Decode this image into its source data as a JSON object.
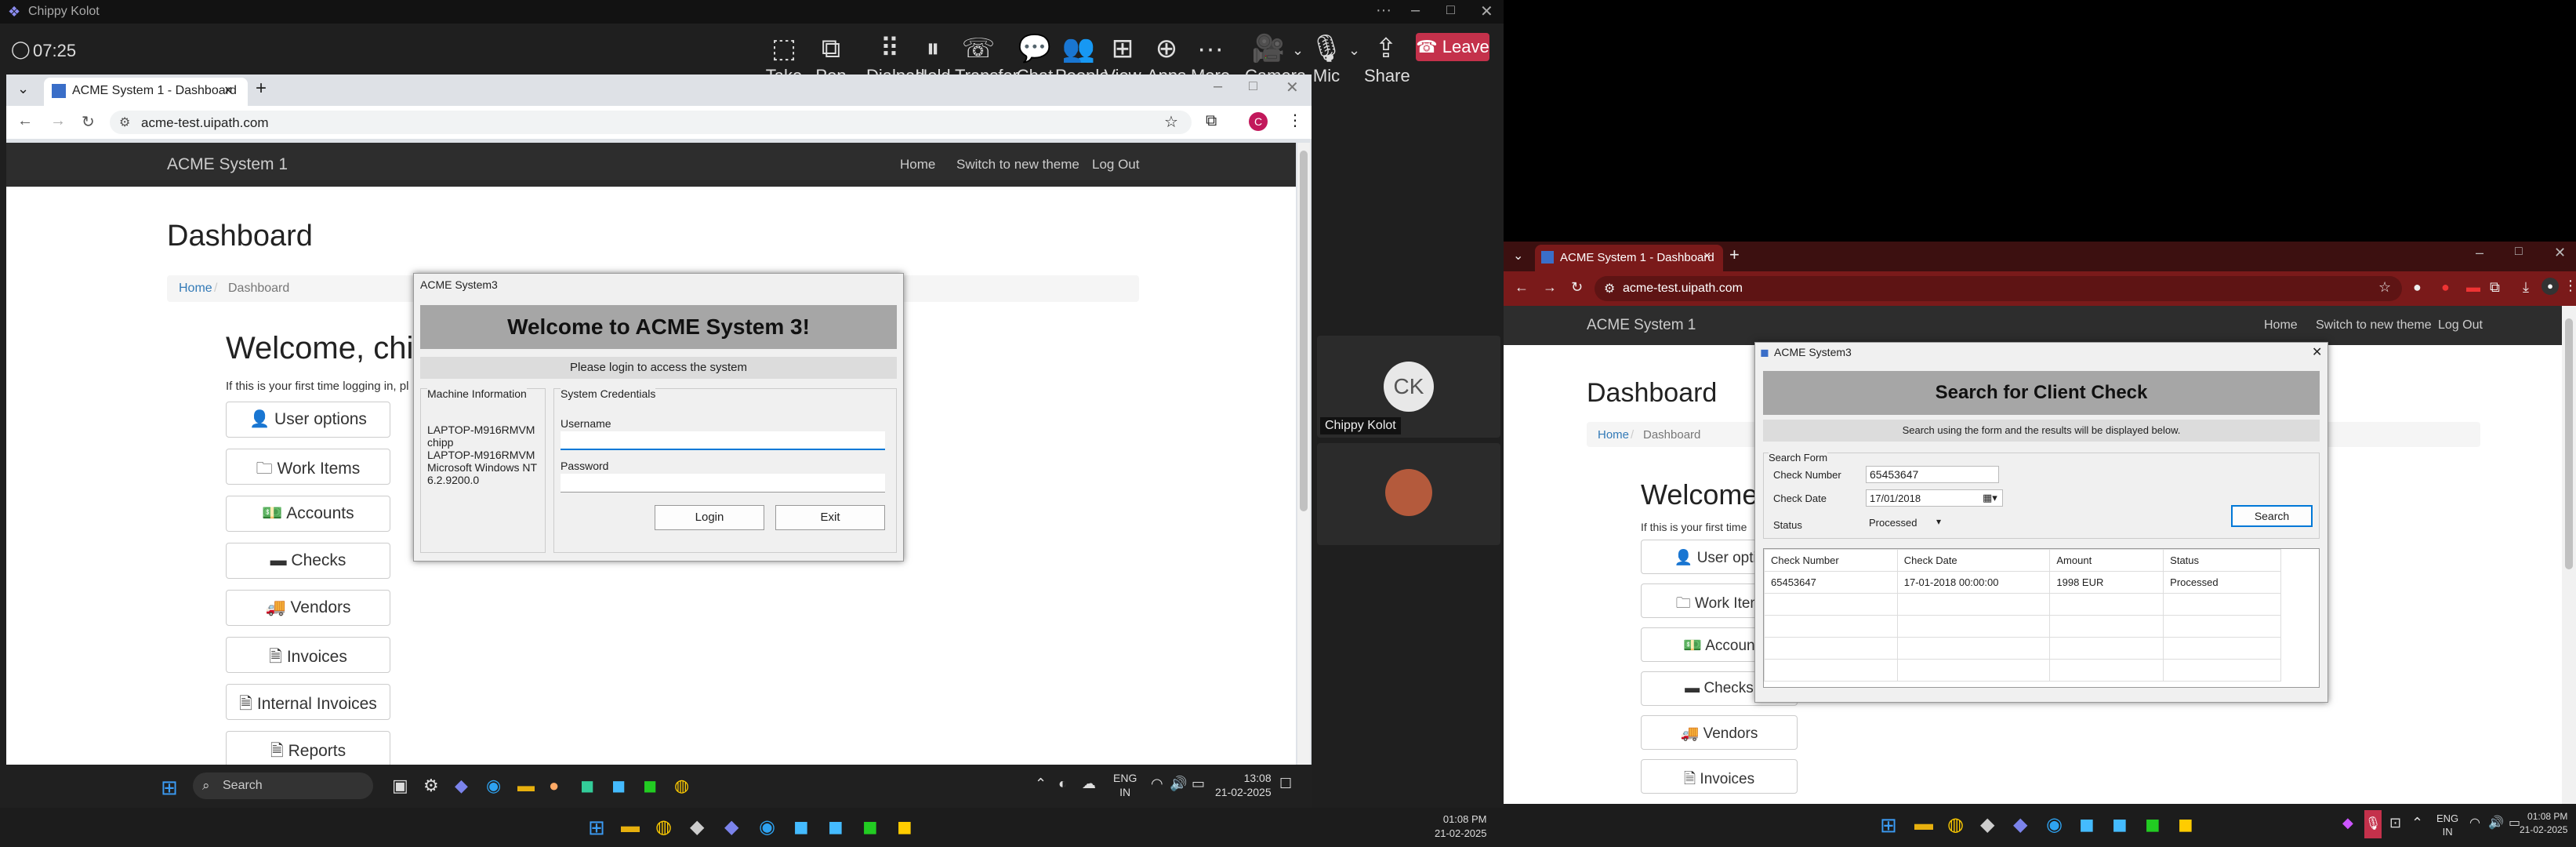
{
  "teams": {
    "title": "Chippy Kolot",
    "timer": "07:25",
    "toolbar": [
      "Take control",
      "Pop out",
      "Dialpad",
      "Hold",
      "Transfer",
      "Chat",
      "People",
      "View",
      "Apps",
      "More",
      "Camera",
      "Mic",
      "Share"
    ],
    "leave": "Leave",
    "participant": "Chippy Kolot",
    "avatar": "CK"
  },
  "left": {
    "tab": "ACME System 1 - Dashboard",
    "url": "acme-test.uipath.com",
    "brand": "ACME System 1",
    "nav": [
      "Home",
      "Switch to new theme",
      "Log Out"
    ],
    "heading": "Dashboard",
    "crumb_home": "Home",
    "crumb_cur": "Dashboard",
    "welcome": "Welcome, chi",
    "hint": "If this is your first time logging in, pl",
    "buttons": [
      "User options",
      "Work Items",
      "Accounts",
      "Checks",
      "Vendors",
      "Invoices",
      "Internal Invoices",
      "Reports"
    ]
  },
  "login": {
    "title": "ACME System3",
    "banner": "Welcome to ACME System 3!",
    "sub": "Please login to access the system",
    "mi_legend": "Machine Information",
    "mi_lines": [
      "LAPTOP-M916RMVM",
      "chipp",
      "LAPTOP-M916RMVM",
      "Microsoft Windows NT",
      "6.2.9200.0"
    ],
    "sc_legend": "System Credentials",
    "user_label": "Username",
    "pass_label": "Password",
    "login": "Login",
    "exit": "Exit"
  },
  "tb_left": {
    "user": "Chippy Kolot",
    "search": "Search",
    "lang1": "ENG",
    "lang2": "IN",
    "time": "13:08",
    "date": "21-02-2025"
  },
  "tb_main": {
    "time": "01:08 PM",
    "date": "21-02-2025"
  },
  "right": {
    "tab": "ACME System 1 - Dashboard",
    "url": "acme-test.uipath.com",
    "brand": "ACME System 1",
    "nav": [
      "Home",
      "Switch to new theme",
      "Log Out"
    ],
    "heading": "Dashboard",
    "crumb_home": "Home",
    "crumb_cur": "Dashboard",
    "welcome": "Welcome",
    "hint": "If this is your first time",
    "buttons": [
      "User optic",
      "Work Item",
      "Accoun",
      "Checks",
      "Vendors",
      "Invoices"
    ]
  },
  "search": {
    "title": "ACME System3",
    "banner": "Search for Client Check",
    "sub": "Search using the form and the results will be displayed below.",
    "legend": "Search Form",
    "f1": "Check Number",
    "v1": "65453647",
    "f2": "Check Date",
    "v2": "17/01/2018",
    "f3": "Status",
    "v3": "Processed",
    "btn": "Search",
    "cols": [
      "Check Number",
      "Check Date",
      "Amount",
      "Status"
    ],
    "row": [
      "65453647",
      "17-01-2018 00:00:00",
      "1998 EUR",
      "Processed"
    ]
  },
  "tb_right": {
    "lang1": "ENG",
    "lang2": "IN",
    "time": "01:08 PM",
    "date": "21-02-2025"
  }
}
